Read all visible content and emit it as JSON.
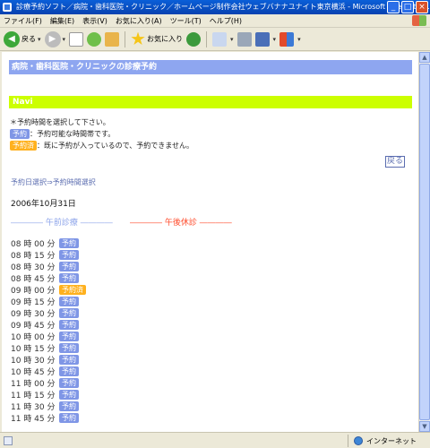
{
  "window": {
    "title": "診療予約ソフト／病院・歯科医院・クリニック／ホームページ制作会社ウェブバナナユナイト東京横浜 - Microsoft Internet E...",
    "buttons": [
      "_",
      "□",
      "×"
    ]
  },
  "menu": [
    "ファイル(F)",
    "編集(E)",
    "表示(V)",
    "お気に入り(A)",
    "ツール(T)",
    "ヘルプ(H)"
  ],
  "toolbar": {
    "back_label": "戻る",
    "favorites_label": "お気に入り"
  },
  "page": {
    "header": "病院・歯科医院・クリニックの診療予約",
    "navi": "Navi",
    "instruction": "＊予約時間を選択して下さい。",
    "legend_available_badge": "予約",
    "legend_available_text": "：予約可能な時間帯です。",
    "legend_taken_badge": "予約済",
    "legend_taken_text": "：既に予約が入っているので、予約できません。",
    "back_link": "戻る",
    "breadcrumb": "予約日選択⇒予約時間選択",
    "date": "2006年10月31日",
    "morning_label": "―――― 午前診療 ――――",
    "afternoon_label": "―――― 午後休診 ――――",
    "slots": [
      {
        "time": "08 時 00 分",
        "status": "予約"
      },
      {
        "time": "08 時 15 分",
        "status": "予約"
      },
      {
        "time": "08 時 30 分",
        "status": "予約"
      },
      {
        "time": "08 時 45 分",
        "status": "予約"
      },
      {
        "time": "09 時 00 分",
        "status": "予約済"
      },
      {
        "time": "09 時 15 分",
        "status": "予約"
      },
      {
        "time": "09 時 30 分",
        "status": "予約"
      },
      {
        "time": "09 時 45 分",
        "status": "予約"
      },
      {
        "time": "10 時 00 分",
        "status": "予約"
      },
      {
        "time": "10 時 15 分",
        "status": "予約"
      },
      {
        "time": "10 時 30 分",
        "status": "予約"
      },
      {
        "time": "10 時 45 分",
        "status": "予約"
      },
      {
        "time": "11 時 00 分",
        "status": "予約"
      },
      {
        "time": "11 時 15 分",
        "status": "予約"
      },
      {
        "time": "11 時 30 分",
        "status": "予約"
      },
      {
        "time": "11 時 45 分",
        "status": "予約"
      }
    ]
  },
  "status": {
    "zone": "インターネット"
  },
  "colors": {
    "header": "#8ea6f0",
    "navi": "#ccff00",
    "available": "#7f96e6",
    "taken": "#ffb11e",
    "afternoon": "#ff4b2b"
  }
}
